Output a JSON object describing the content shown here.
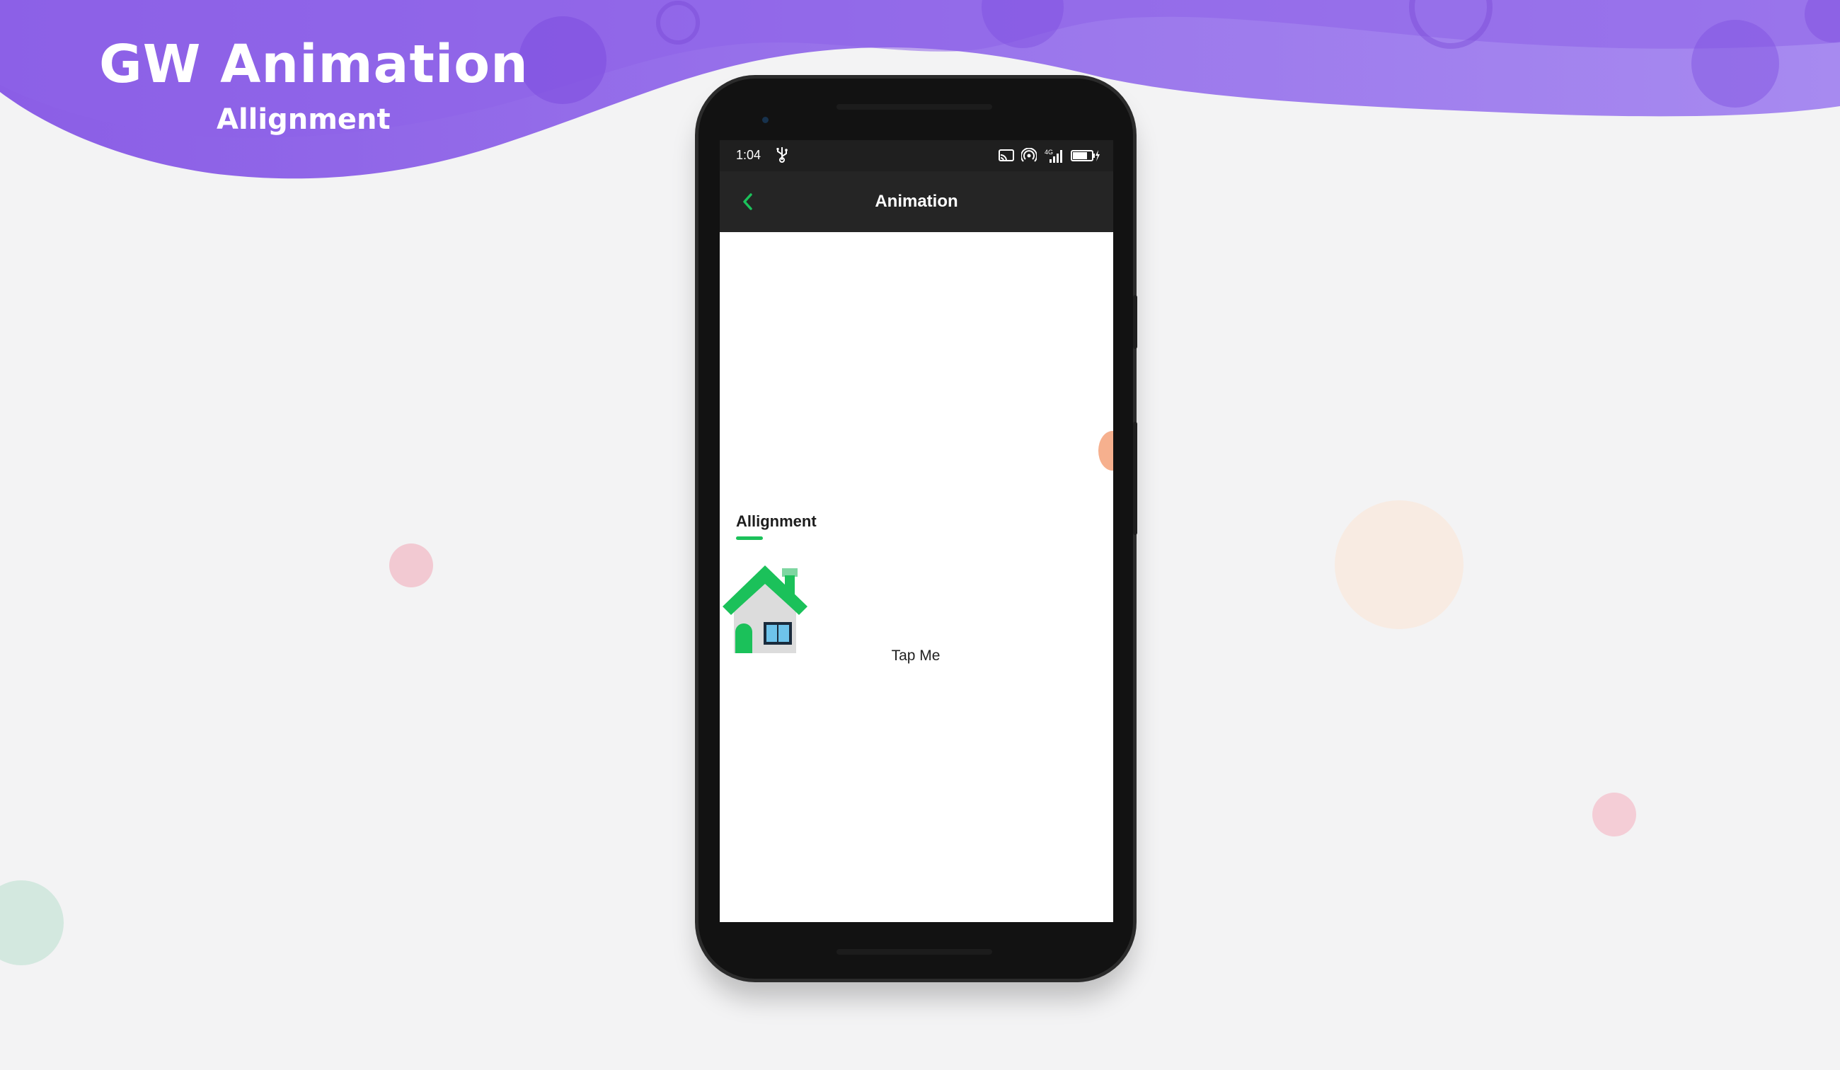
{
  "promo": {
    "title": "GW Animation",
    "subtitle": "Allignment",
    "accent_color": "#9a72ee"
  },
  "phone": {
    "status_bar": {
      "time": "1:04",
      "icons": [
        "usb-icon",
        "cast-icon",
        "hotspot-icon",
        "signal-4g-icon",
        "battery-charging-icon"
      ]
    },
    "app_bar": {
      "back_icon": "chevron-left-icon",
      "title": "Animation",
      "back_color": "#1bc15a"
    },
    "content": {
      "section_label": "Allignment",
      "underline_color": "#1bc15a",
      "image_icon": "house-icon",
      "button_label": "Tap Me"
    }
  }
}
